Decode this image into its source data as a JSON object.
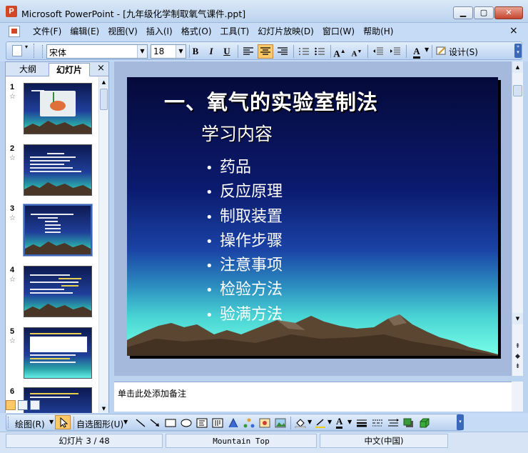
{
  "window": {
    "title": "Microsoft PowerPoint - [九年级化学制取氧气课件.ppt]",
    "icon": "powerpoint-icon",
    "controls": {
      "minimize": "▁",
      "maximize": "▢",
      "close": "✕"
    }
  },
  "menu": {
    "items": [
      "文件(F)",
      "编辑(E)",
      "视图(V)",
      "插入(I)",
      "格式(O)",
      "工具(T)",
      "幻灯片放映(D)",
      "窗口(W)",
      "帮助(H)"
    ],
    "close_doc": "×"
  },
  "toolbar": {
    "font_name": "宋体",
    "font_size": "18",
    "bold": "B",
    "italic": "I",
    "underline": "U",
    "font_color": "A",
    "grow_font": "A",
    "shrink_font": "A",
    "design_label": "设计(S)",
    "active_button": "align-center"
  },
  "left_pane": {
    "tab_outline": "大纲",
    "tab_slides": "幻灯片",
    "close": "×",
    "slides": [
      {
        "number": "1",
        "selected": false
      },
      {
        "number": "2",
        "selected": false
      },
      {
        "number": "3",
        "selected": true
      },
      {
        "number": "4",
        "selected": false
      },
      {
        "number": "5",
        "selected": false
      },
      {
        "number": "6",
        "selected": false
      }
    ],
    "transition_icon": "☆"
  },
  "slide": {
    "title": "一、氧气的实验室制法",
    "subtitle": "学习内容",
    "bullet_char": "•",
    "bullets": [
      "药品",
      "反应原理",
      "制取装置",
      "操作步骤",
      "注意事项",
      "检验方法",
      "验满方法"
    ]
  },
  "notes": {
    "placeholder": "单击此处添加备注"
  },
  "drawing_toolbar": {
    "draw_label": "绘图(R)",
    "autoshapes_label": "自选图形(U)"
  },
  "statusbar": {
    "slide_info": "幻灯片 3 / 48",
    "design_name": "Mountain Top",
    "language": "中文(中国)"
  },
  "colors": {
    "accent": "#fcc868",
    "slide_top": "#050a3a",
    "slide_bottom": "#78ffe7",
    "window_bg": "#c6dbf5"
  }
}
